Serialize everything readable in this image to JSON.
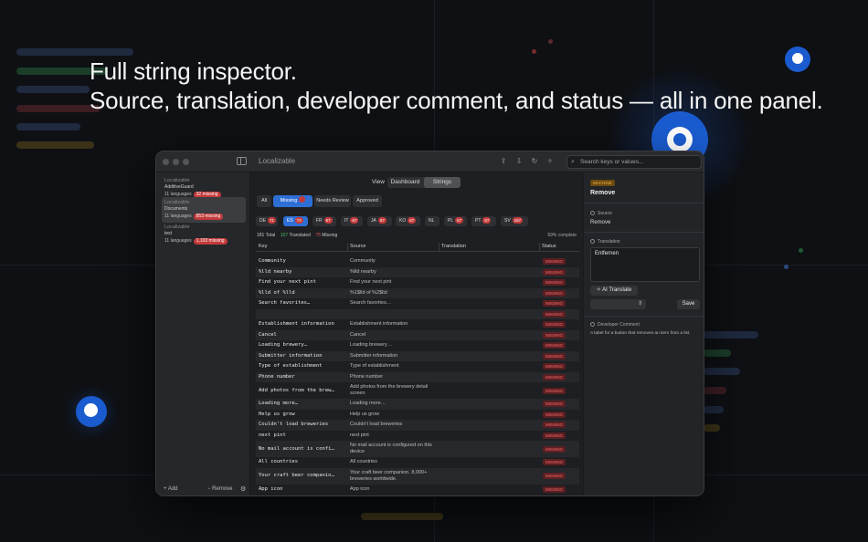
{
  "headline": {
    "line1": "Full string inspector.",
    "line2": "Source, translation, developer comment, and status — all in one panel."
  },
  "window": {
    "title": "Localizable",
    "search_placeholder": "Search keys or values..."
  },
  "sidebar": {
    "projects": [
      {
        "title": "Localizable",
        "name": "AdditiveGuard",
        "languages": "11 languages",
        "missing": "32 missing",
        "selected": false
      },
      {
        "title": "Localizable",
        "name": "Documents",
        "languages": "11 languages",
        "missing": "853 missing",
        "selected": true
      },
      {
        "title": "Localizable",
        "name": "test",
        "languages": "11 languages",
        "missing": "1,103 missing",
        "selected": false
      }
    ],
    "add_label": "Add",
    "remove_label": "Remove"
  },
  "main": {
    "view_label": "View",
    "view_tabs": [
      "Dashboard",
      "Strings"
    ],
    "view_active": "Strings",
    "filters": [
      "All",
      "Missing",
      "Needs Review",
      "Approved"
    ],
    "filter_active": "Missing",
    "languages": [
      {
        "code": "DE",
        "count": "71"
      },
      {
        "code": "ES",
        "count": "73"
      },
      {
        "code": "FR",
        "count": "67"
      },
      {
        "code": "IT",
        "count": "67"
      },
      {
        "code": "JA",
        "count": "67"
      },
      {
        "code": "KO",
        "count": "67"
      },
      {
        "code": "NL",
        "count": ""
      },
      {
        "code": "PL",
        "count": "67"
      },
      {
        "code": "PT",
        "count": "67"
      },
      {
        "code": "SV",
        "count": "167"
      }
    ],
    "language_selected": "ES",
    "stats": {
      "total": "181",
      "total_label": "Total",
      "translated": "107",
      "translated_label": "Translated",
      "missing": "75",
      "missing_label": "Missing",
      "complete": "59% complete"
    },
    "columns": [
      "Key",
      "Source",
      "Translation",
      "Status"
    ],
    "rows": [
      {
        "key": "Community",
        "source": "Community",
        "status": "MISSING"
      },
      {
        "key": "%lld nearby",
        "source": "%lld nearby",
        "status": "MISSING"
      },
      {
        "key": "Find your next pint",
        "source": "Find your next pint",
        "status": "MISSING"
      },
      {
        "key": "%lld of %lld",
        "source": "%1$lld of %2$lld",
        "status": "MISSING"
      },
      {
        "key": "Search favorites…",
        "source": "Search favorites…",
        "status": "MISSING"
      },
      {
        "key": "",
        "source": "",
        "status": "MISSING"
      },
      {
        "key": "Establishment information",
        "source": "Establishment information",
        "status": "MISSING"
      },
      {
        "key": "Cancel",
        "source": "Cancel",
        "status": "MISSING"
      },
      {
        "key": "Loading brewery…",
        "source": "Loading brewery…",
        "status": "MISSING"
      },
      {
        "key": "Submitter information",
        "source": "Submitter information",
        "status": "MISSING"
      },
      {
        "key": "Type of establishment",
        "source": "Type of establishment",
        "status": "MISSING"
      },
      {
        "key": "Phone number",
        "source": "Phone number",
        "status": "MISSING"
      },
      {
        "key": "Add photos from the brew…",
        "source": "Add photos from the brewery detail screen",
        "status": "MISSING"
      },
      {
        "key": "Loading more…",
        "source": "Loading more…",
        "status": "MISSING"
      },
      {
        "key": "Help us grow",
        "source": "Help us grow",
        "status": "MISSING"
      },
      {
        "key": "Couldn't load breweries",
        "source": "Couldn't load breweries",
        "status": "MISSING"
      },
      {
        "key": "next pint",
        "source": "next pint",
        "status": "MISSING"
      },
      {
        "key": "No mail account is confi…",
        "source": "No mail account is configured on this device",
        "status": "MISSING"
      },
      {
        "key": "All countries",
        "source": "All countries",
        "status": "MISSING"
      },
      {
        "key": "Your craft beer companio…",
        "source": "Your craft beer companion. 8,000+ breweries worldwide.",
        "status": "MISSING"
      },
      {
        "key": "App icon",
        "source": "App icon",
        "status": "MISSING"
      }
    ]
  },
  "inspector": {
    "badge": "MACHINE",
    "title": "Remove",
    "source_label": "Source",
    "source_value": "Remove",
    "translation_label": "Translation",
    "translation_value": "Entfernen",
    "ai_button": "AI Translate",
    "save_button": "Save",
    "dev_comment_label": "Developer Comment",
    "dev_comment": "A label for a button that removes an item from a list."
  },
  "colors": {
    "accent": "#2e6fd6",
    "missing": "#c43a3a",
    "machine": "#f0b347",
    "translated": "#4bbf6b"
  }
}
